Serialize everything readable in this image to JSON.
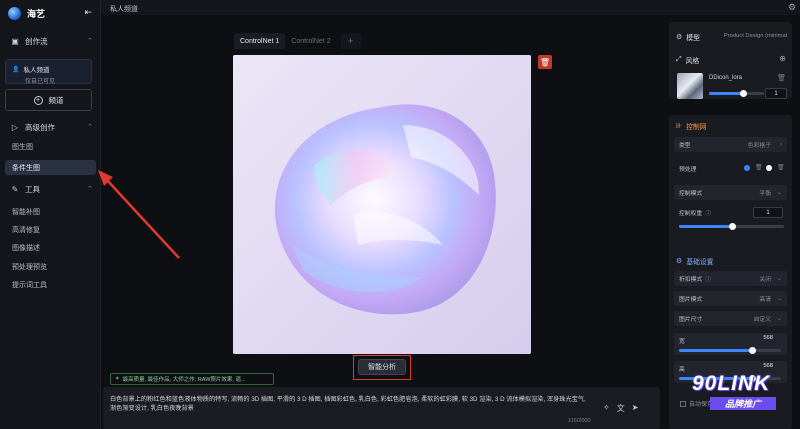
{
  "brand": {
    "name": "海艺",
    "icon": "logo-orb",
    "collapse_icon": "collapse-sidebar-icon"
  },
  "sidebar": {
    "sections": [
      {
        "label": "创作流",
        "icon": "workflow-icon"
      },
      {
        "label": "高级创作",
        "icon": "play-icon"
      },
      {
        "label": "工具",
        "icon": "tools-icon"
      }
    ],
    "channel_card": {
      "title": "私人频道",
      "subtitle": "仅自己可见"
    },
    "channel_button": "频道",
    "advanced_items": [
      "图生图",
      "条件生图"
    ],
    "active_item": "条件生图",
    "tool_items": [
      "智能补图",
      "高清修复",
      "图像描述",
      "预处理预览",
      "提示词工具"
    ]
  },
  "topbar": {
    "title": "私人频道"
  },
  "tabs": [
    "ControlNet 1",
    "ControlNet 2",
    "+"
  ],
  "analyze_button": "智能分析",
  "tag_chip": "最高质量, 最佳作品, 大师之作, RAW照片效果, 逼...",
  "prompt": {
    "text": "白色背景上的粉红色和蓝色液体物质的特写, 流畅的 3D 插图, 平滑的 3 D 插图, 插图彩虹色, 乳白色, 彩虹色肥皂泡, 柔软的虹彩膜, 软 3D 渲染, 3 D 流体模拟渲染, 浑身珠光宝气, 渐色渐变设计, 乳白色夜晚背景",
    "count": "116/2000"
  },
  "right_panel": {
    "model": {
      "label": "模型",
      "value": "Product Design (minimal"
    },
    "style": {
      "label": "风格",
      "lora_name": "DDicon_lora",
      "weight": "1",
      "weight_fraction": 0.6
    },
    "controlnet": {
      "label": "控制网",
      "type_label": "类型",
      "type_value": "色彩格子",
      "preprocess_label": "预处理",
      "mode_label": "控制模式",
      "mode_value": "平衡",
      "weight_label": "控制权重",
      "weight_value": "1",
      "weight_fraction": 0.5
    },
    "basic": {
      "label": "基础设置",
      "hires_label": "折扣模式",
      "hires_value": "关闭",
      "image_mode_label": "图片模式",
      "image_mode_value": "高清",
      "size_label": "图片尺寸",
      "size_value": "自定义",
      "width_label": "宽",
      "width_value": "568",
      "width_fraction": 0.72,
      "height_label": "高",
      "height_value": "568",
      "height_fraction": 0.72
    }
  },
  "watermark": {
    "main": "90LINK",
    "sub": "品牌推广"
  },
  "checkbox_label": "自动保存",
  "colors": {
    "accent": "#3d86ff",
    "highlight": "#e03a2c",
    "active_bg": "#2a3143"
  }
}
